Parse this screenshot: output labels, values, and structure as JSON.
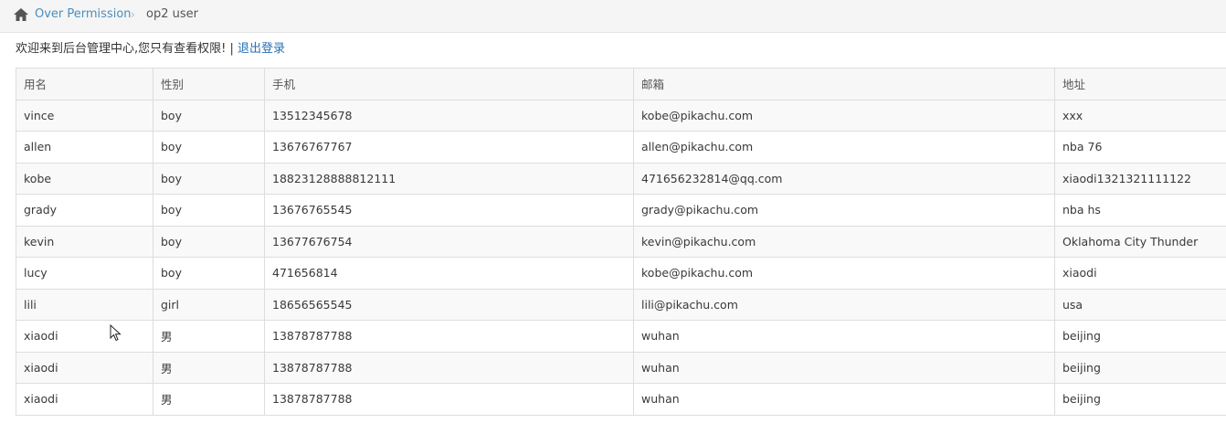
{
  "breadcrumb": {
    "home_icon": "home-icon",
    "parent_label": "Over Permission",
    "separator": "›",
    "current_label": "op2 user"
  },
  "welcome": {
    "text": "欢迎来到后台管理中心,您只有查看权限! | ",
    "logout_label": "退出登录"
  },
  "table": {
    "headers": [
      "用名",
      "性别",
      "手机",
      "邮箱",
      "地址"
    ],
    "rows": [
      [
        "vince",
        "boy",
        "13512345678",
        "kobe@pikachu.com",
        "xxx"
      ],
      [
        "allen",
        "boy",
        "13676767767",
        "allen@pikachu.com",
        "nba 76"
      ],
      [
        "kobe",
        "boy",
        "18823128888812111",
        "471656232814@qq.com",
        "xiaodi1321321111122"
      ],
      [
        "grady",
        "boy",
        "13676765545",
        "grady@pikachu.com",
        "nba hs"
      ],
      [
        "kevin",
        "boy",
        "13677676754",
        "kevin@pikachu.com",
        "Oklahoma City Thunder"
      ],
      [
        "lucy",
        "boy",
        "471656814",
        "kobe@pikachu.com",
        "xiaodi"
      ],
      [
        "lili",
        "girl",
        "18656565545",
        "lili@pikachu.com",
        "usa"
      ],
      [
        "xiaodi",
        "男",
        "13878787788",
        "wuhan",
        "beijing"
      ],
      [
        "xiaodi",
        "男",
        "13878787788",
        "wuhan",
        "beijing"
      ],
      [
        "xiaodi",
        "男",
        "13878787788",
        "wuhan",
        "beijing"
      ]
    ]
  },
  "colors": {
    "link": "#4c8fbd",
    "breadcrumb_bg": "#f5f5f5",
    "table_border": "#dddddd"
  }
}
